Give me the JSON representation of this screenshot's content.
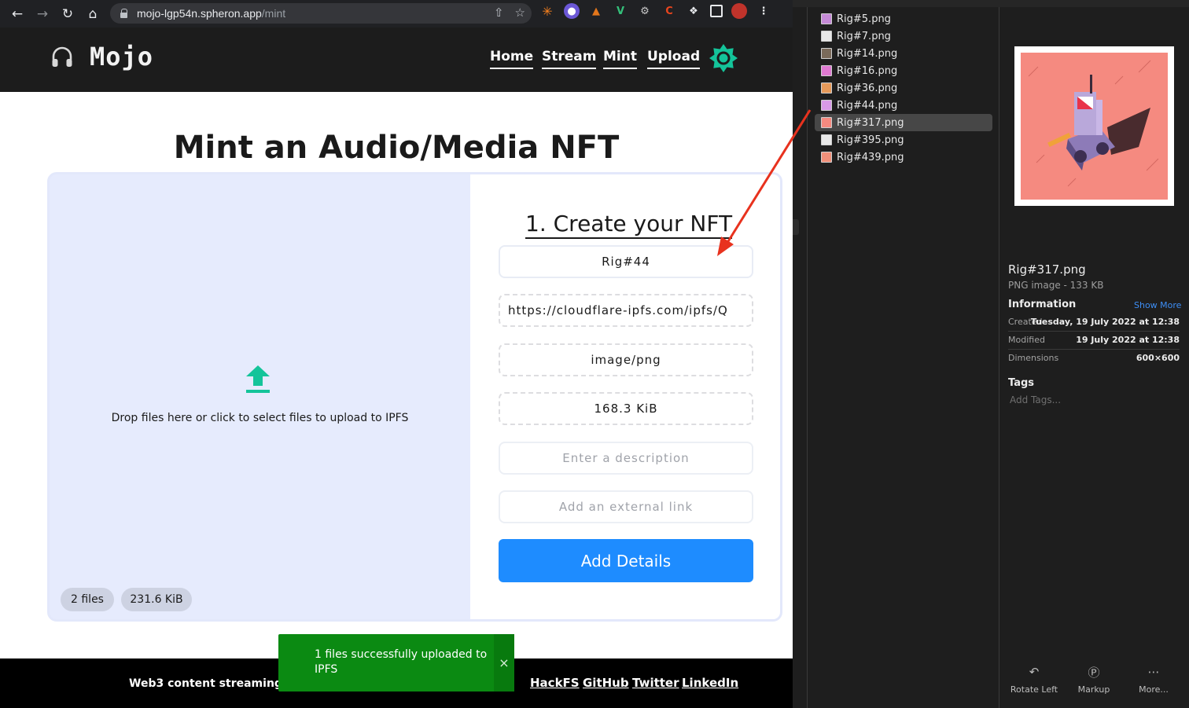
{
  "browser": {
    "url_host": "mojo-lgp54n.spheron.app",
    "url_path": "/mint"
  },
  "site": {
    "brand": "Mojo",
    "nav": [
      "Home",
      "Stream",
      "Mint",
      "Upload"
    ],
    "page_title": "Mint an Audio/Media NFT"
  },
  "dropzone": {
    "hint": "Drop files here or click to select files to upload to IPFS",
    "file_count": "2 files",
    "total_size": "231.6 KiB"
  },
  "form": {
    "title": "1. Create your NFT",
    "name_value": "Rig#44",
    "url_value": "https://cloudflare-ipfs.com/ipfs/Q",
    "mime_value": "image/png",
    "size_value": "168.3 KiB",
    "description_placeholder": "Enter a description",
    "external_link_placeholder": "Add an external link",
    "submit_label": "Add Details"
  },
  "footer": {
    "tagline": "Web3 content streaming po",
    "links": [
      "HackFS",
      "GitHub",
      "Twitter",
      "LinkedIn"
    ]
  },
  "toast": {
    "message": "1 files successfully uploaded to IPFS",
    "close": "×"
  },
  "finder": {
    "files": [
      {
        "name": "Rig#5.png",
        "thumb": "#c58ad6"
      },
      {
        "name": "Rig#7.png",
        "thumb": "#e8e8e8"
      },
      {
        "name": "Rig#14.png",
        "thumb": "#7a6a5a"
      },
      {
        "name": "Rig#16.png",
        "thumb": "#e07ad2"
      },
      {
        "name": "Rig#36.png",
        "thumb": "#e79a5a"
      },
      {
        "name": "Rig#44.png",
        "thumb": "#d89ae8"
      },
      {
        "name": "Rig#317.png",
        "thumb": "#f58a80"
      },
      {
        "name": "Rig#395.png",
        "thumb": "#e8e8e8"
      },
      {
        "name": "Rig#439.png",
        "thumb": "#f0907a"
      }
    ],
    "selected_index": 6,
    "preview": {
      "name": "Rig#317.png",
      "kind": "PNG image - 133 KB",
      "info_heading": "Information",
      "show_more": "Show More",
      "info": [
        {
          "key": "Created",
          "value": "Tuesday, 19 July 2022 at 12:38"
        },
        {
          "key": "Modified",
          "value": "19 July 2022 at 12:38"
        },
        {
          "key": "Dimensions",
          "value": "600×600"
        }
      ],
      "tags_heading": "Tags",
      "tags_placeholder": "Add Tags..."
    },
    "quick_actions": [
      "Rotate Left",
      "Markup",
      "More..."
    ]
  },
  "colors": {
    "accent_blue": "#1e8cff",
    "toast_green": "#0b8a12",
    "brand_teal": "#14c49a",
    "annotation_red": "#e8321e"
  }
}
